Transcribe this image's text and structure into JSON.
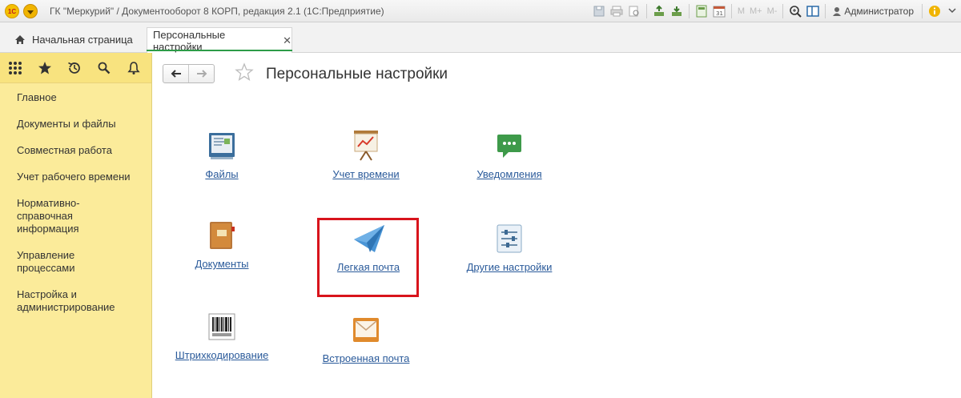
{
  "titlebar": {
    "logo": "1С",
    "title": "ГК \"Меркурий\" / Документооборот 8 КОРП, редакция 2.1  (1С:Предприятие)",
    "m_labels": [
      "M",
      "M+",
      "M-"
    ],
    "user": "Администратор"
  },
  "tabs": {
    "home": "Начальная страница",
    "active": "Персональные настройки",
    "close": "✕"
  },
  "sidebar": {
    "items": [
      "Главное",
      "Документы и файлы",
      "Совместная работа",
      "Учет рабочего времени",
      "Нормативно-справочная информация",
      "Управление процессами",
      "Настройка и администрирование"
    ]
  },
  "main": {
    "title": "Персональные настройки",
    "commands": [
      {
        "label": "Файлы",
        "icon": "files-icon"
      },
      {
        "label": "Учет времени",
        "icon": "time-tracking-icon"
      },
      {
        "label": "Уведомления",
        "icon": "notifications-icon"
      },
      {
        "label": "Документы",
        "icon": "documents-icon"
      },
      {
        "label": "Легкая почта",
        "icon": "paper-plane-icon"
      },
      {
        "label": "Другие настройки",
        "icon": "sliders-icon"
      },
      {
        "label": "Штрихкодирование",
        "icon": "barcode-icon"
      },
      {
        "label": "Встроенная почта",
        "icon": "envelope-icon"
      }
    ]
  },
  "colors": {
    "sidebar": "#fbeb9a",
    "link": "#2a5a9a",
    "highlight": "#d8141c",
    "active_tab_line": "#2d9c48"
  }
}
